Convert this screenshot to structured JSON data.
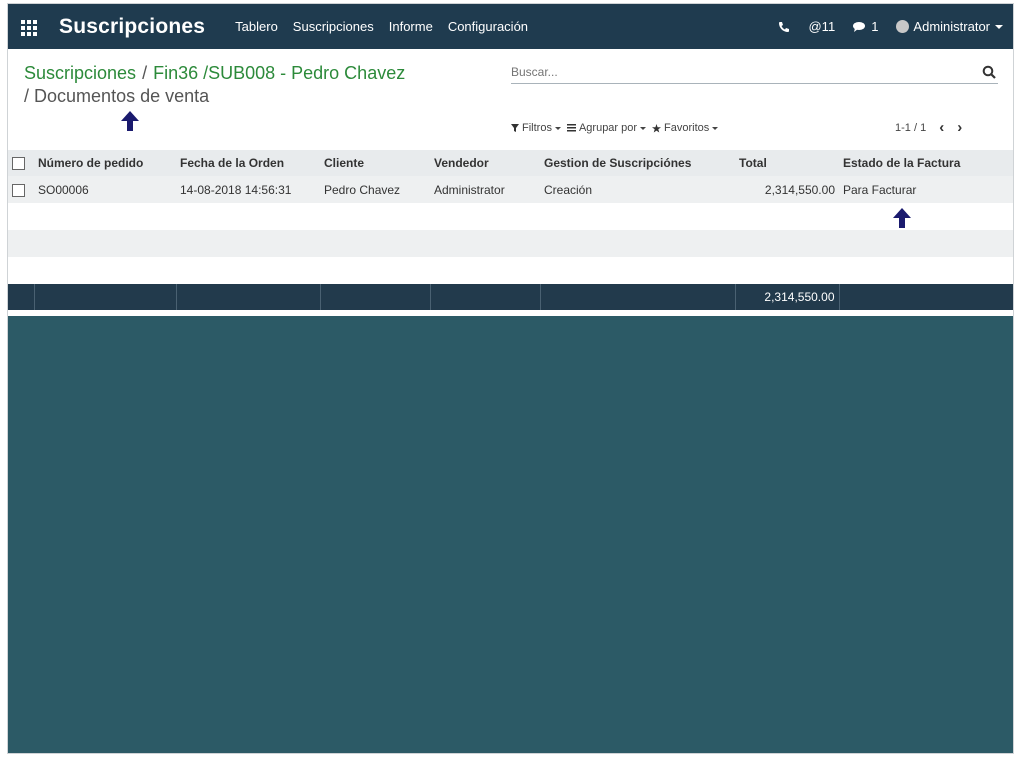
{
  "app": {
    "title": "Suscripciones",
    "menu": [
      "Tablero",
      "Suscripciones",
      "Informe",
      "Configuración"
    ],
    "messages_count": "@11",
    "chat_count": "1",
    "user": "Administrator"
  },
  "breadcrumb": {
    "root": "Suscripciones",
    "record": "Fin36 /SUB008 - Pedro Chavez",
    "current": "Documentos de venta"
  },
  "search": {
    "placeholder": "Buscar..."
  },
  "filters": {
    "filters_label": "Filtros",
    "group_label": "Agrupar por",
    "favorites_label": "Favoritos"
  },
  "pager": {
    "range": "1-1 / 1"
  },
  "table": {
    "columns": [
      "Número de pedido",
      "Fecha de la Orden",
      "Cliente",
      "Vendedor",
      "Gestion de Suscripciónes",
      "Total",
      "Estado de la Factura"
    ],
    "rows": [
      {
        "order": "SO00006",
        "date": "14-08-2018 14:56:31",
        "customer": "Pedro Chavez",
        "salesperson": "Administrator",
        "management": "Creación",
        "total": "2,314,550.00",
        "invoice_status": "Para Facturar"
      }
    ],
    "footer_total": "2,314,550.00"
  },
  "colors": {
    "nav_bg": "#1f3b4f",
    "link_green": "#2c8a3a",
    "empty_bg": "#2c5a66",
    "arrow": "#1a1a6e"
  }
}
